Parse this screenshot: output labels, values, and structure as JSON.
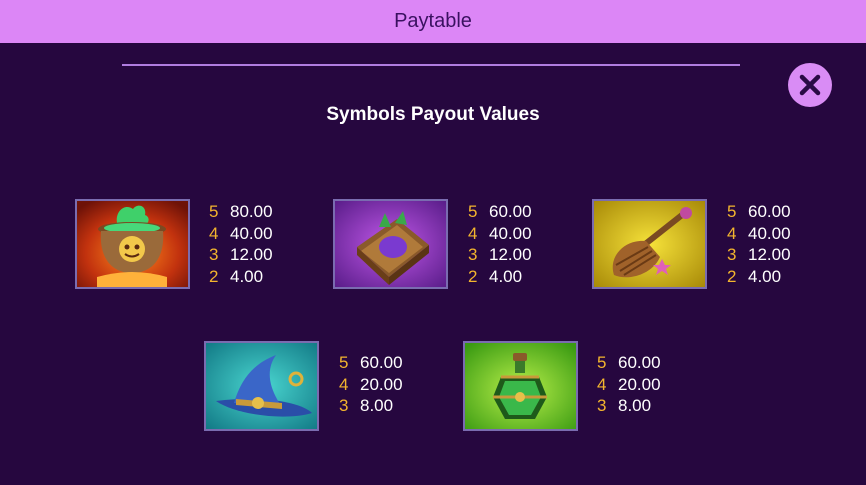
{
  "header": {
    "title": "Paytable"
  },
  "close": {
    "icon": "close-icon"
  },
  "section": {
    "title": "Symbols Payout Values"
  },
  "colors": {
    "header_bg": "#dc86f6",
    "page_bg": "#26073f",
    "count_color": "#f3b52e",
    "close_bg": "#d98cf5"
  },
  "symbols": [
    {
      "icon": "cauldron-icon",
      "pays": [
        {
          "count": "5",
          "value": "80.00"
        },
        {
          "count": "4",
          "value": "40.00"
        },
        {
          "count": "3",
          "value": "12.00"
        },
        {
          "count": "2",
          "value": "4.00"
        }
      ]
    },
    {
      "icon": "spellbook-icon",
      "pays": [
        {
          "count": "5",
          "value": "60.00"
        },
        {
          "count": "4",
          "value": "40.00"
        },
        {
          "count": "3",
          "value": "12.00"
        },
        {
          "count": "2",
          "value": "4.00"
        }
      ]
    },
    {
      "icon": "broom-icon",
      "pays": [
        {
          "count": "5",
          "value": "60.00"
        },
        {
          "count": "4",
          "value": "40.00"
        },
        {
          "count": "3",
          "value": "12.00"
        },
        {
          "count": "2",
          "value": "4.00"
        }
      ]
    },
    {
      "icon": "witch-hat-icon",
      "pays": [
        {
          "count": "5",
          "value": "60.00"
        },
        {
          "count": "4",
          "value": "20.00"
        },
        {
          "count": "3",
          "value": "8.00"
        }
      ]
    },
    {
      "icon": "potion-icon",
      "pays": [
        {
          "count": "5",
          "value": "60.00"
        },
        {
          "count": "4",
          "value": "20.00"
        },
        {
          "count": "3",
          "value": "8.00"
        }
      ]
    }
  ]
}
